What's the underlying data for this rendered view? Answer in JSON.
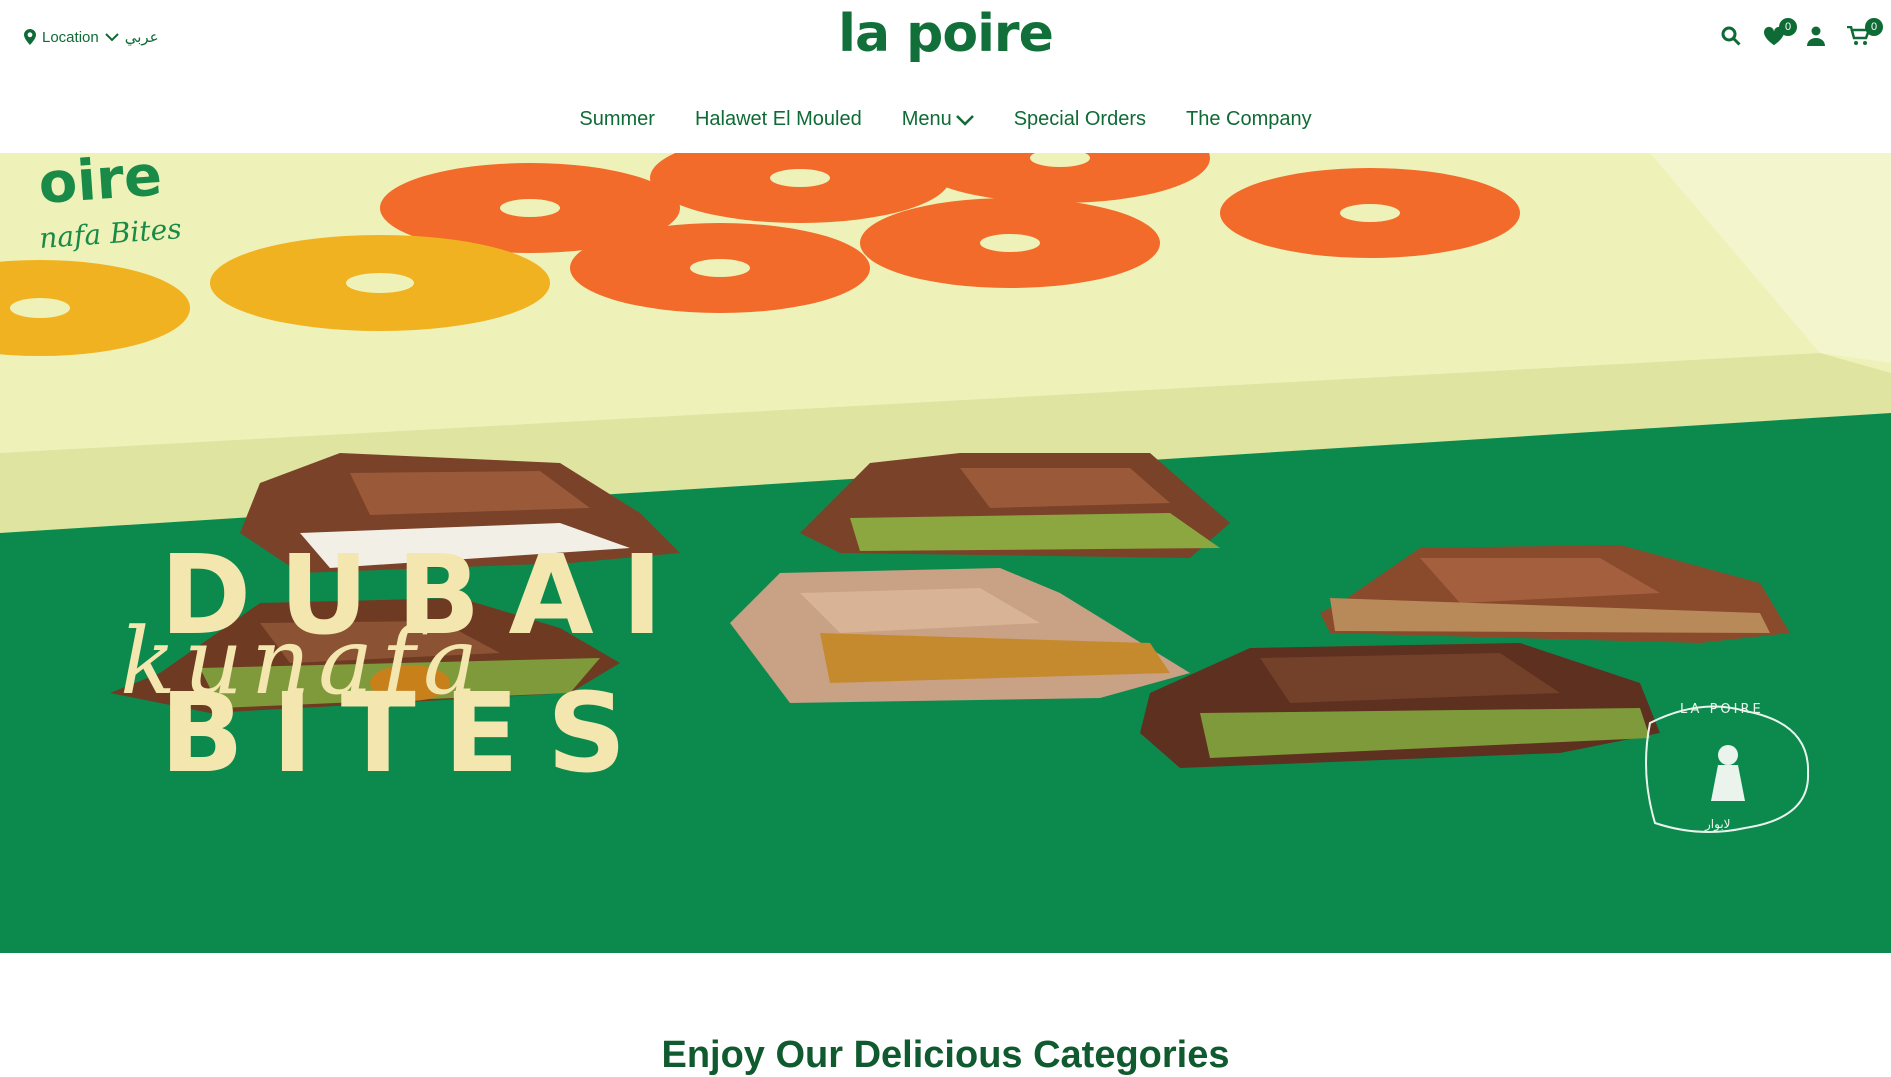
{
  "header": {
    "location_label": "Location",
    "language_label": "عربي",
    "logo_text": "la poire",
    "wishlist_count": "0",
    "cart_count": "0"
  },
  "nav": {
    "items": [
      {
        "label": "Summer"
      },
      {
        "label": "Halawet El Mouled"
      },
      {
        "label": "Menu"
      },
      {
        "label": "Special Orders"
      },
      {
        "label": "The Company"
      }
    ]
  },
  "hero": {
    "title_line1": "DUBAI",
    "title_script": "kunafa",
    "title_line3": "BITES",
    "box_brand": "oire",
    "box_subtitle": "nafa Bites",
    "seal_text": "LA POIRE",
    "seal_arabic": "لابوار"
  },
  "section": {
    "title": "Enjoy Our Delicious Categories"
  },
  "colors": {
    "brand_green": "#0f6b35",
    "hero_green": "#0c8a4e",
    "box_cream": "#eef2b8",
    "dot_orange": "#f26b2a",
    "dot_yellow": "#f1b221"
  }
}
